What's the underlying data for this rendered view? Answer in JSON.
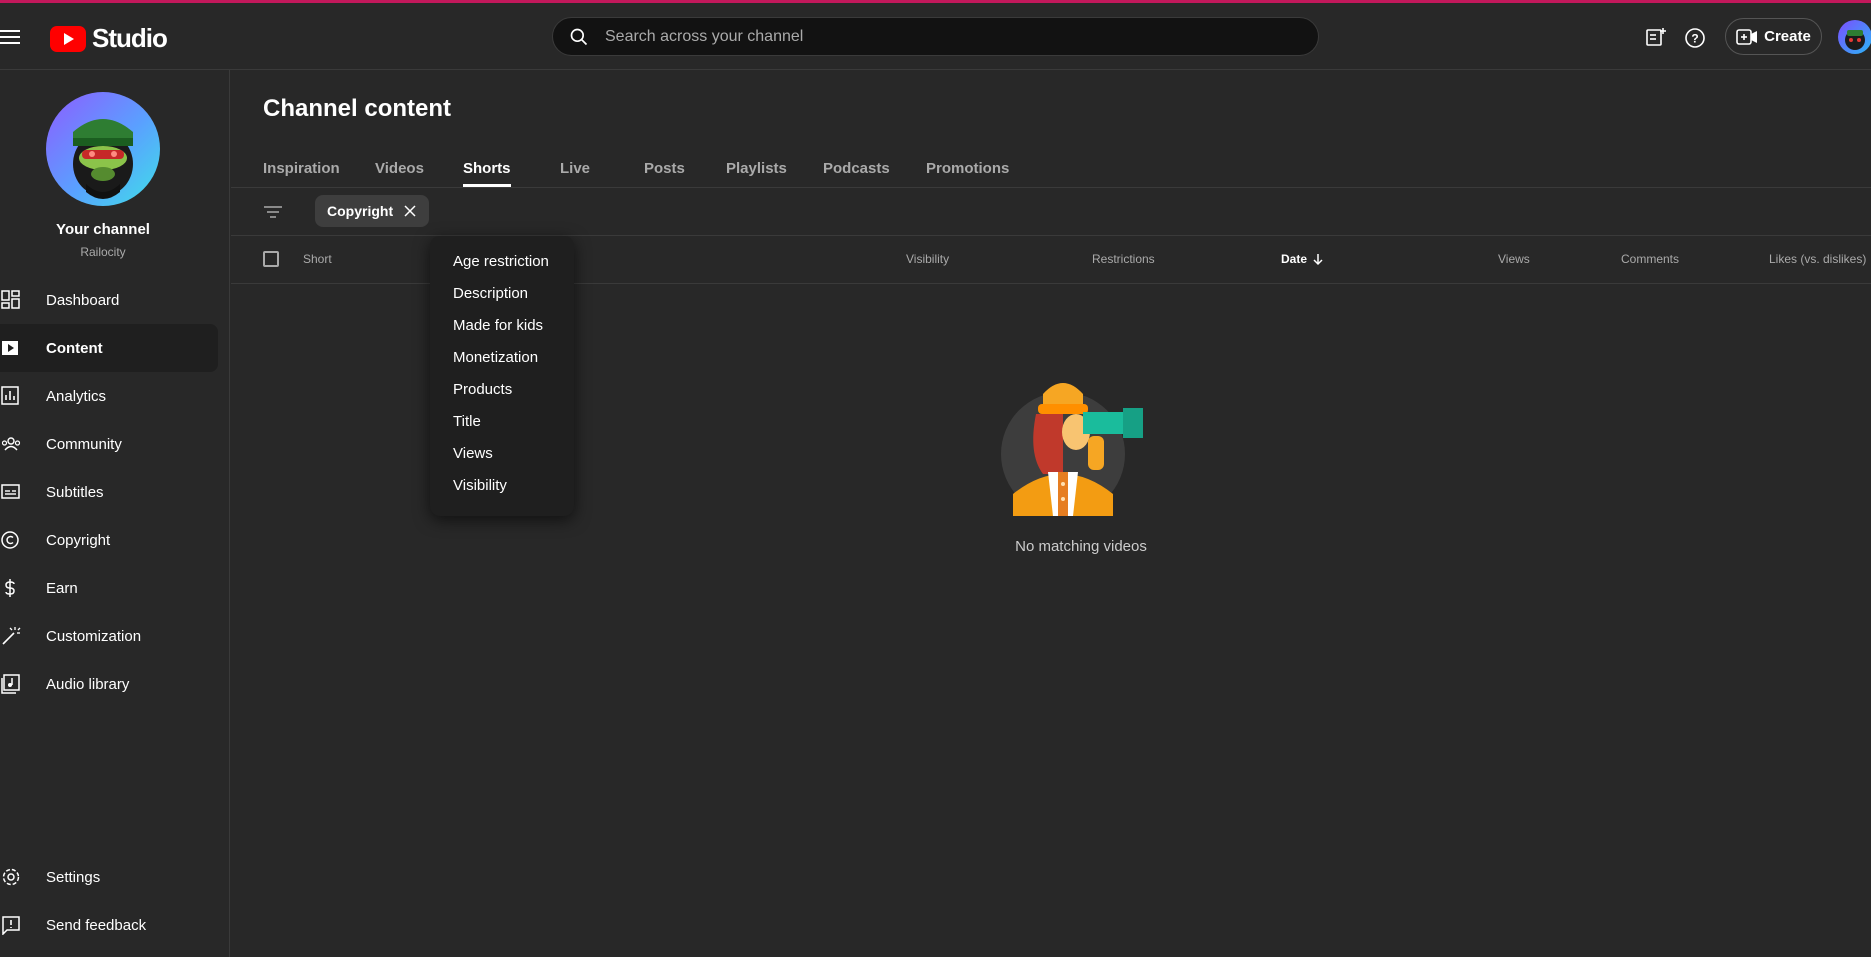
{
  "app": {
    "logo_text": "Studio"
  },
  "search": {
    "placeholder": "Search across your channel"
  },
  "header": {
    "create_label": "Create"
  },
  "channel": {
    "name": "Your channel",
    "handle": "Railocity"
  },
  "sidebar": {
    "items": [
      {
        "label": "Dashboard",
        "icon": "dashboard-icon"
      },
      {
        "label": "Content",
        "icon": "content-icon",
        "active": true
      },
      {
        "label": "Analytics",
        "icon": "analytics-icon"
      },
      {
        "label": "Community",
        "icon": "community-icon"
      },
      {
        "label": "Subtitles",
        "icon": "subtitles-icon"
      },
      {
        "label": "Copyright",
        "icon": "copyright-icon"
      },
      {
        "label": "Earn",
        "icon": "dollar-icon"
      },
      {
        "label": "Customization",
        "icon": "magic-wand-icon"
      },
      {
        "label": "Audio library",
        "icon": "audio-library-icon"
      }
    ],
    "footer": [
      {
        "label": "Settings",
        "icon": "gear-icon"
      },
      {
        "label": "Send feedback",
        "icon": "feedback-icon"
      }
    ]
  },
  "main": {
    "title": "Channel content",
    "tabs": [
      {
        "label": "Inspiration"
      },
      {
        "label": "Videos"
      },
      {
        "label": "Shorts",
        "active": true
      },
      {
        "label": "Live"
      },
      {
        "label": "Posts"
      },
      {
        "label": "Playlists"
      },
      {
        "label": "Podcasts"
      },
      {
        "label": "Promotions"
      }
    ],
    "filter_chip": "Copyright",
    "columns": [
      "Short",
      "Visibility",
      "Restrictions",
      "Date",
      "Views",
      "Comments",
      "Likes (vs. dislikes)"
    ],
    "sort_column": "Date",
    "empty_text": "No matching videos"
  },
  "filter_menu": {
    "items": [
      "Age restriction",
      "Description",
      "Made for kids",
      "Monetization",
      "Products",
      "Title",
      "Views",
      "Visibility"
    ]
  },
  "colors": {
    "background": "#282828",
    "accent": "#c2185b",
    "youtube_red": "#ff0000"
  }
}
